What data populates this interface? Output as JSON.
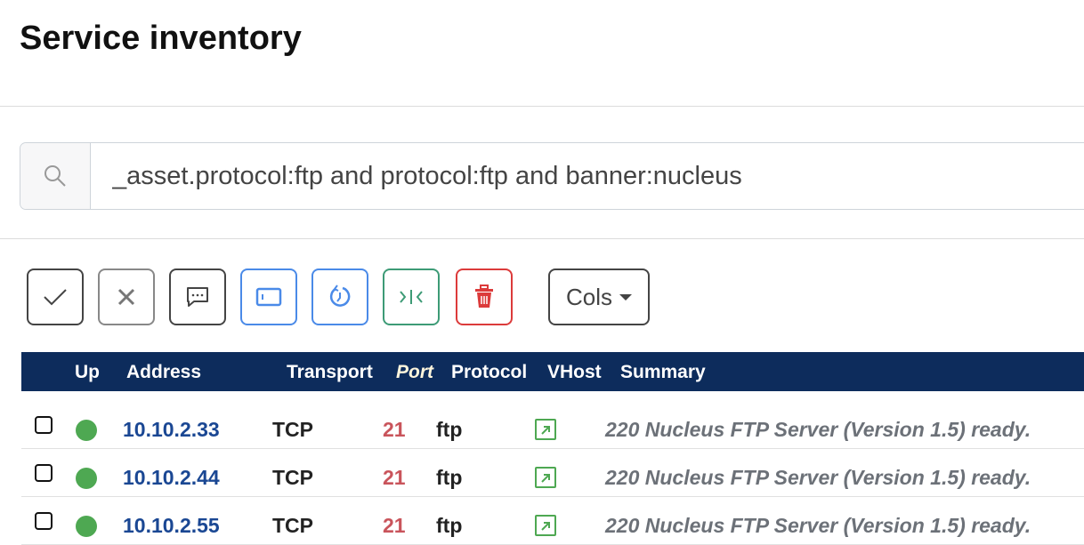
{
  "page": {
    "title": "Service inventory"
  },
  "search": {
    "value": "_asset.protocol:ftp and protocol:ftp and banner:nucleus",
    "icon": "search-icon"
  },
  "toolbar": {
    "buttons": [
      {
        "name": "verify-button",
        "icon": "check-icon",
        "color": "#444444"
      },
      {
        "name": "reject-button",
        "icon": "x-icon",
        "color": "#888888"
      },
      {
        "name": "comment-button",
        "icon": "chat-icon",
        "color": "#444444"
      },
      {
        "name": "window-button",
        "icon": "window-icon",
        "color": "#4a8ae8"
      },
      {
        "name": "history-button",
        "icon": "clock-rotate-icon",
        "color": "#4a8ae8"
      },
      {
        "name": "merge-button",
        "icon": "collapse-icon",
        "color": "#3d9b76"
      },
      {
        "name": "delete-button",
        "icon": "trash-icon",
        "color": "#dc3b3b"
      }
    ],
    "cols_label": "Cols"
  },
  "table": {
    "headers": {
      "up": "Up",
      "address": "Address",
      "transport": "Transport",
      "port": "Port",
      "protocol": "Protocol",
      "vhost": "VHost",
      "summary": "Summary"
    },
    "rows": [
      {
        "address": "10.10.2.33",
        "transport": "TCP",
        "port": "21",
        "protocol": "ftp",
        "summary": "220 Nucleus FTP Server (Version 1.5) ready.",
        "status": "up"
      },
      {
        "address": "10.10.2.44",
        "transport": "TCP",
        "port": "21",
        "protocol": "ftp",
        "summary": "220 Nucleus FTP Server (Version 1.5) ready.",
        "status": "up"
      },
      {
        "address": "10.10.2.55",
        "transport": "TCP",
        "port": "21",
        "protocol": "ftp",
        "summary": "220 Nucleus FTP Server (Version 1.5) ready.",
        "status": "up"
      }
    ]
  },
  "colors": {
    "header_bg": "#0d2c5c",
    "up": "#4ea852",
    "address": "#1a4793",
    "port": "#c9545b"
  }
}
